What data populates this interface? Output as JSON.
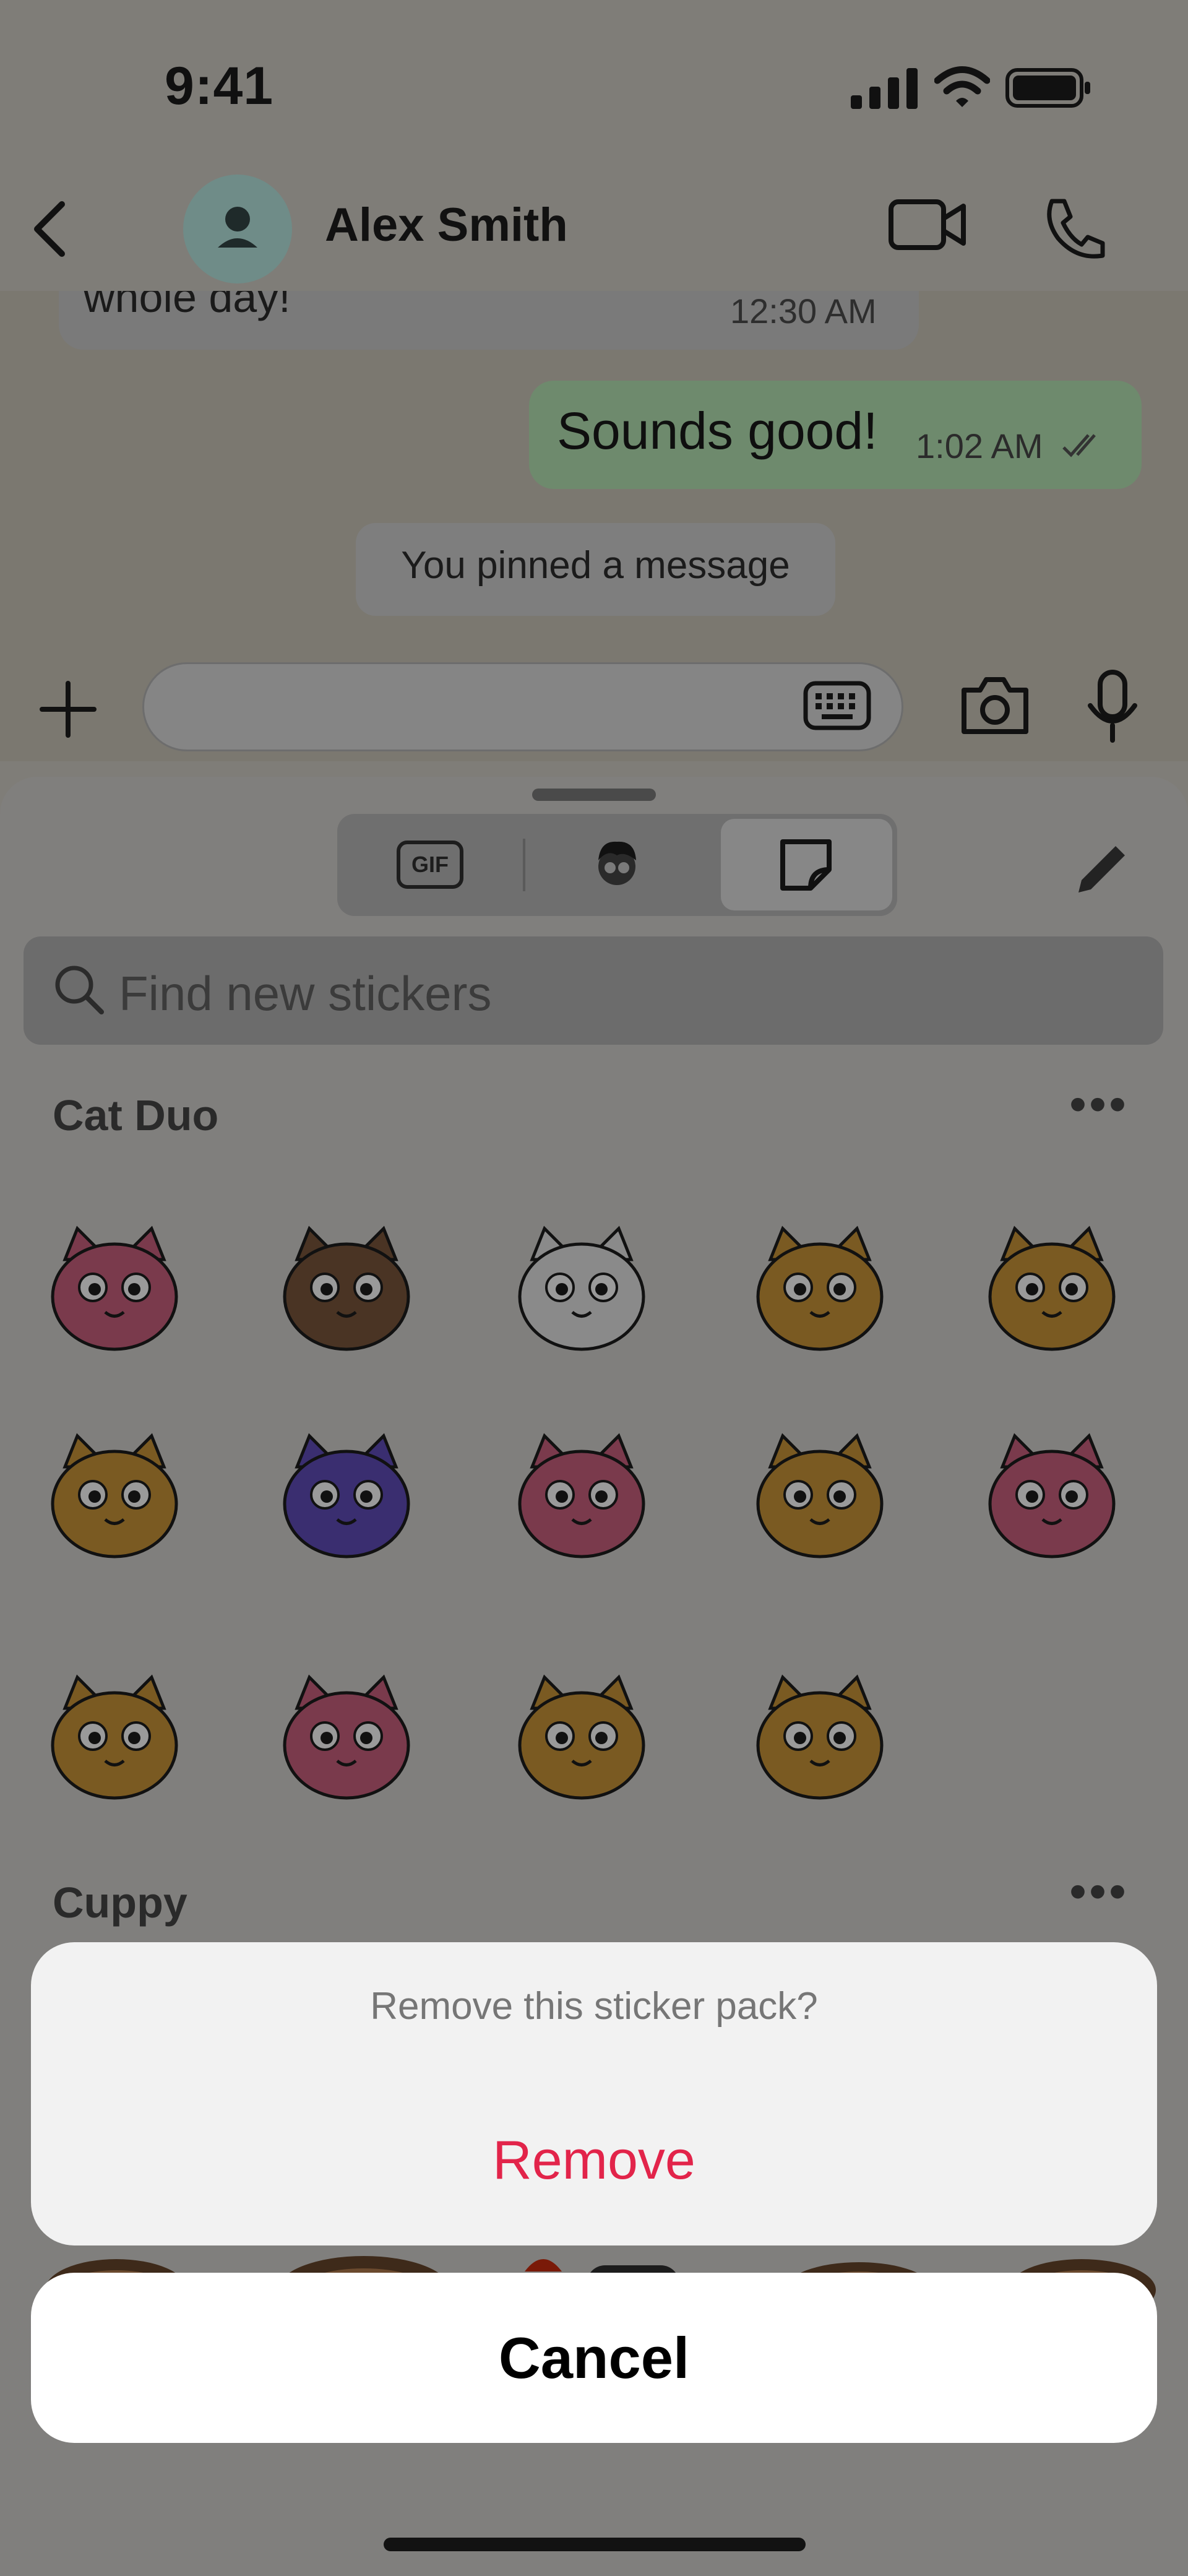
{
  "status_bar": {
    "time": "9:41"
  },
  "chat_header": {
    "contact_name": "Alex Smith"
  },
  "messages": {
    "incoming": {
      "text": "whole day!",
      "time": "12:30 AM"
    },
    "outgoing": {
      "text": "Sounds good!",
      "time": "1:02 AM"
    },
    "system": "You pinned a message"
  },
  "composer": {
    "placeholder": ""
  },
  "sticker_panel": {
    "tabs": [
      "GIF",
      "avatar",
      "stickers"
    ],
    "active_tab": "stickers",
    "search_placeholder": "Find new stickers",
    "packs": [
      {
        "name": "Cat Duo",
        "sticker_count": 14
      },
      {
        "name": "Cuppy"
      }
    ]
  },
  "action_sheet": {
    "title": "Remove this sticker pack?",
    "destructive_label": "Remove",
    "cancel_label": "Cancel"
  },
  "colors": {
    "destructive": "#e2244a",
    "outgoing_bubble": "#d9fdd3",
    "accent_teal": "#7ec2c0"
  }
}
